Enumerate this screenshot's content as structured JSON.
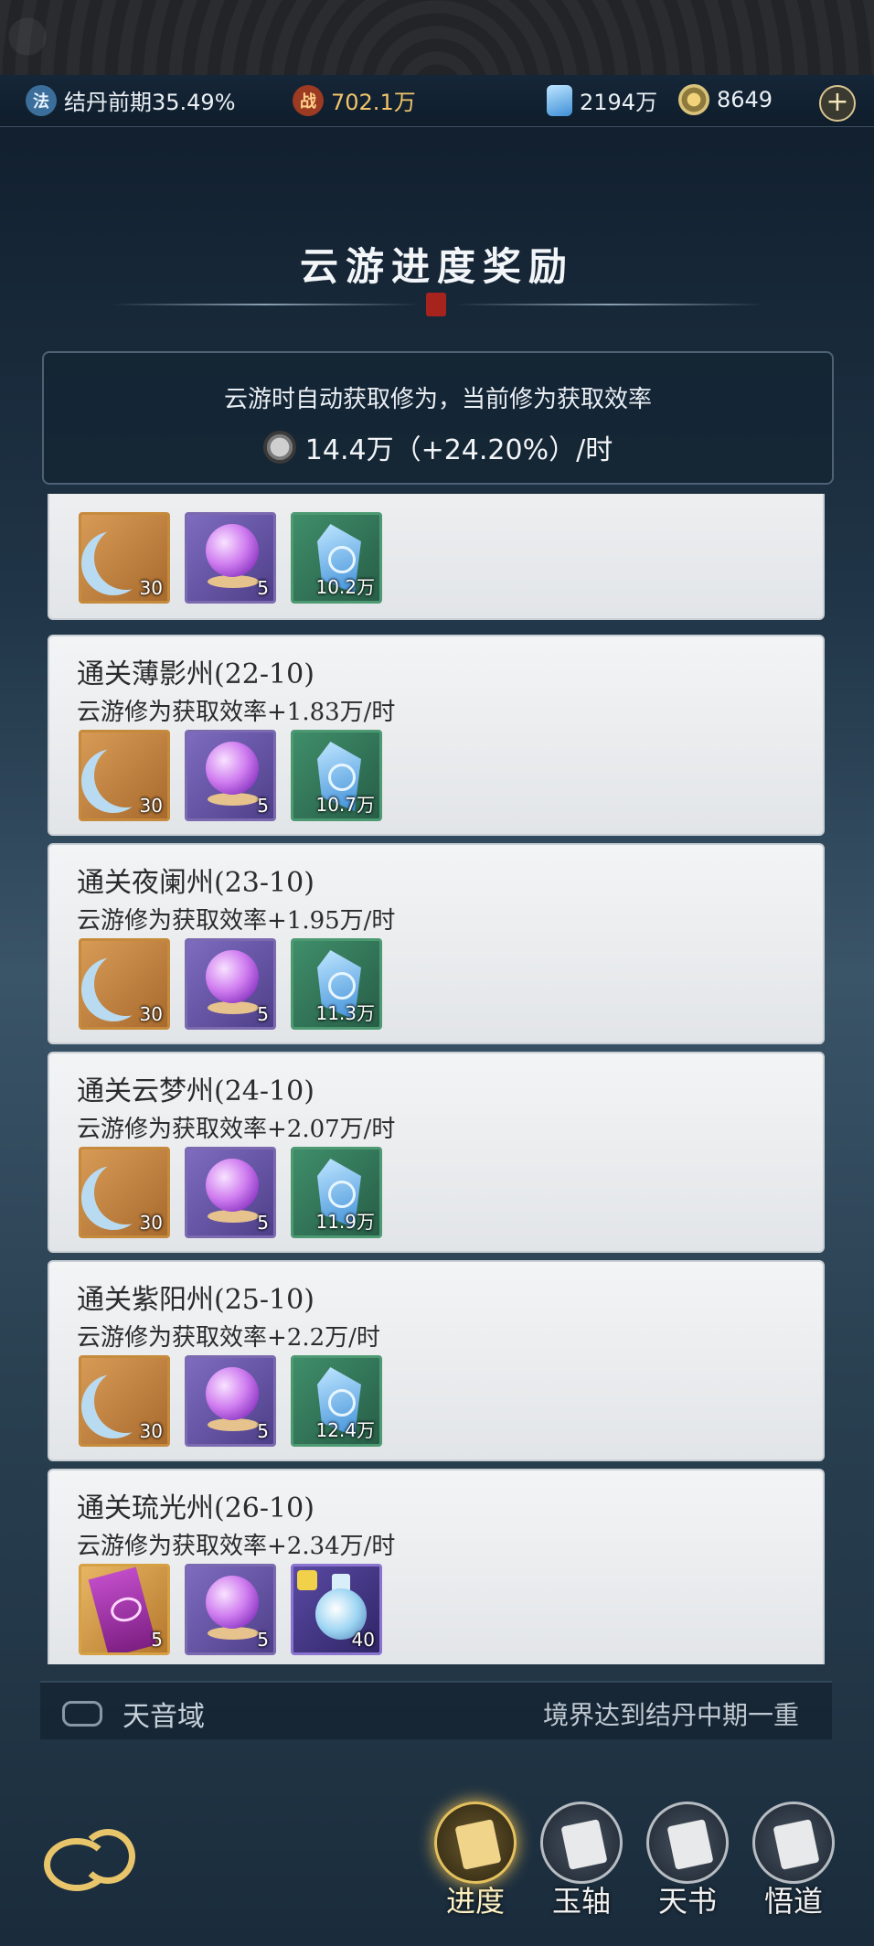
{
  "topbar": {
    "realm_icon_glyph": "法",
    "realm": "结丹前期35.49%",
    "power_icon_glyph": "战",
    "power": "702.1万",
    "spirit_stone": "2194万",
    "jade": "8649",
    "plus_glyph": "+"
  },
  "page": {
    "title": "云游进度奖励",
    "info_line1": "云游时自动获取修为，当前修为获取效率",
    "info_line2": "14.4万（+24.20%）/时"
  },
  "rewards": [
    {
      "title": "",
      "subtitle": "",
      "items": [
        {
          "icon": "moon-blade-icon",
          "count": "30"
        },
        {
          "icon": "purple-orb-icon",
          "count": "5"
        },
        {
          "icon": "spirit-crystal-icon",
          "count": "10.2万"
        }
      ]
    },
    {
      "title": "通关薄影州(22-10)",
      "subtitle": "云游修为获取效率+1.83万/时",
      "items": [
        {
          "icon": "moon-blade-icon",
          "count": "30"
        },
        {
          "icon": "purple-orb-icon",
          "count": "5"
        },
        {
          "icon": "spirit-crystal-icon",
          "count": "10.7万"
        }
      ]
    },
    {
      "title": "通关夜阑州(23-10)",
      "subtitle": "云游修为获取效率+1.95万/时",
      "items": [
        {
          "icon": "moon-blade-icon",
          "count": "30"
        },
        {
          "icon": "purple-orb-icon",
          "count": "5"
        },
        {
          "icon": "spirit-crystal-icon",
          "count": "11.3万"
        }
      ]
    },
    {
      "title": "通关云梦州(24-10)",
      "subtitle": "云游修为获取效率+2.07万/时",
      "items": [
        {
          "icon": "moon-blade-icon",
          "count": "30"
        },
        {
          "icon": "purple-orb-icon",
          "count": "5"
        },
        {
          "icon": "spirit-crystal-icon",
          "count": "11.9万"
        }
      ]
    },
    {
      "title": "通关紫阳州(25-10)",
      "subtitle": "云游修为获取效率+2.2万/时",
      "items": [
        {
          "icon": "moon-blade-icon",
          "count": "30"
        },
        {
          "icon": "purple-orb-icon",
          "count": "5"
        },
        {
          "icon": "spirit-crystal-icon",
          "count": "12.4万"
        }
      ]
    },
    {
      "title": "通关琉光州(26-10)",
      "subtitle": "云游修为获取效率+2.34万/时",
      "items": [
        {
          "icon": "talisman-banner-icon",
          "count": "5"
        },
        {
          "icon": "purple-orb-icon",
          "count": "5"
        },
        {
          "icon": "elixir-flask-icon",
          "count": "40"
        }
      ]
    }
  ],
  "zone": {
    "name": "天音域",
    "requirement": "境界达到结丹中期一重"
  },
  "nav": [
    {
      "label": "进度",
      "active": true
    },
    {
      "label": "玉轴",
      "active": false
    },
    {
      "label": "天书",
      "active": false
    },
    {
      "label": "悟道",
      "active": false
    }
  ],
  "colors": {
    "gold": "#e4c15e",
    "card_bg": "#eceef0",
    "bg_dark": "#0e1a28"
  }
}
